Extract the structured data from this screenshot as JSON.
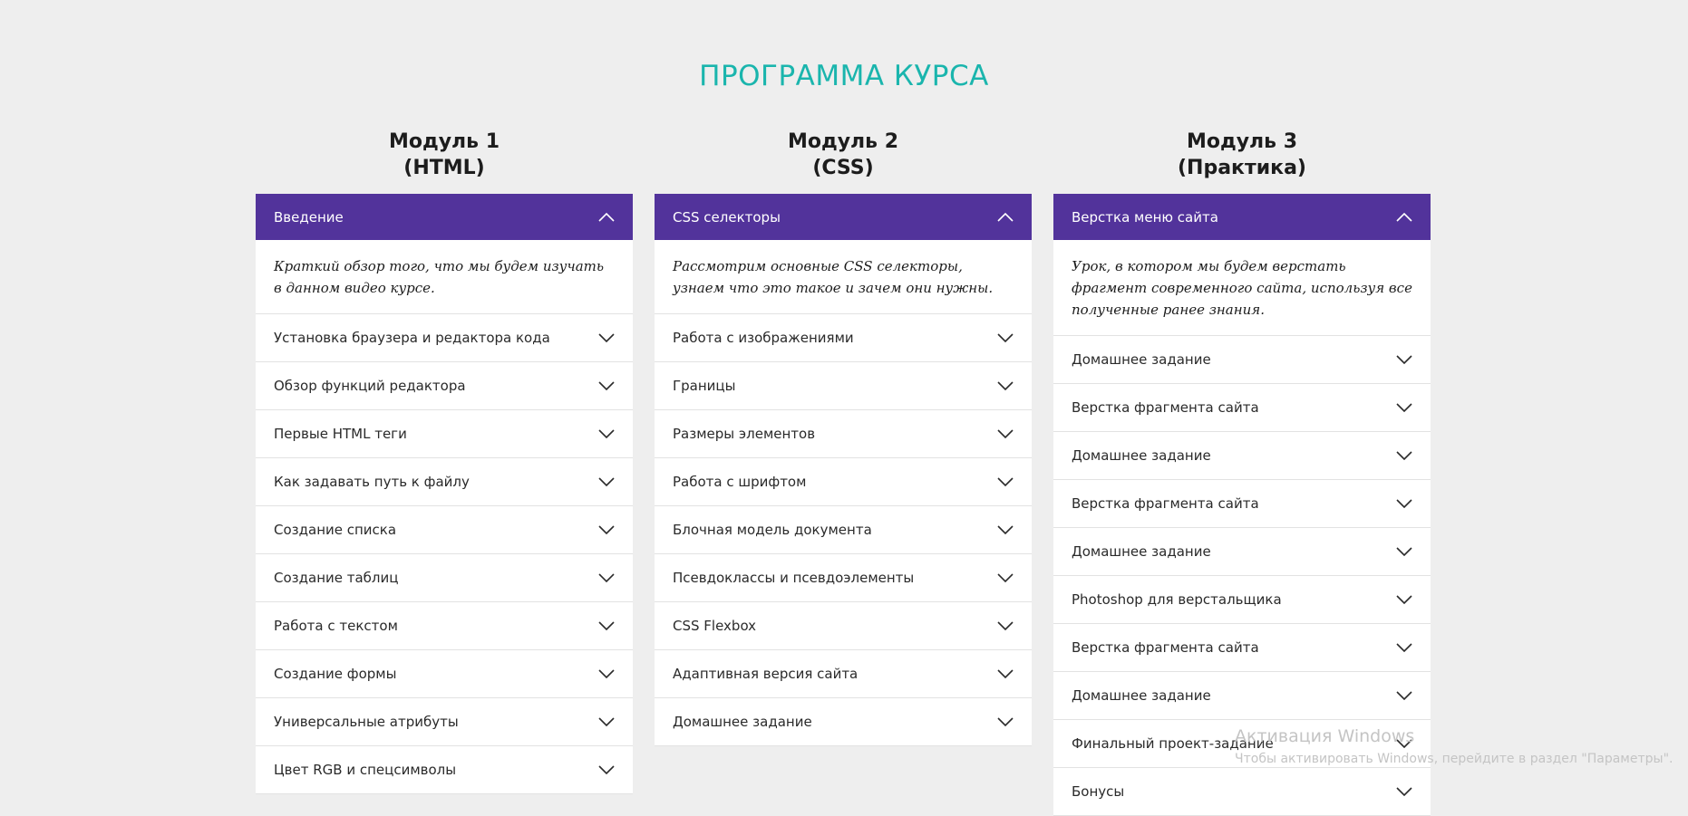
{
  "page": {
    "title": "ПРОГРАММА КУРСА"
  },
  "modules": [
    {
      "title_line1": "Модуль 1",
      "title_line2": "(HTML)",
      "open_item": {
        "label": "Введение",
        "description": "Краткий обзор того, что мы будем изучать в данном видео курсе."
      },
      "items": [
        "Установка браузера и редактора кода",
        "Обзор функций редактора",
        "Первые HTML теги",
        "Как задавать путь к файлу",
        "Создание списка",
        "Создание таблиц",
        "Работа с текстом",
        "Создание формы",
        "Универсальные атрибуты",
        "Цвет RGB и спецсимволы"
      ]
    },
    {
      "title_line1": "Модуль 2",
      "title_line2": "(CSS)",
      "open_item": {
        "label": "CSS селекторы",
        "description": "Рассмотрим основные CSS селекторы, узнаем что это такое и зачем они нужны."
      },
      "items": [
        "Работа с изображениями",
        "Границы",
        "Размеры элементов",
        "Работа с шрифтом",
        "Блочная модель документа",
        "Псевдоклассы и псевдоэлементы",
        "CSS Flexbox",
        "Адаптивная версия сайта",
        "Домашнее задание"
      ]
    },
    {
      "title_line1": "Модуль 3",
      "title_line2": "(Практика)",
      "open_item": {
        "label": "Верстка меню сайта",
        "description": "Урок, в котором мы будем верстать фрагмент современного сайта, используя все полученные ранее знания."
      },
      "items": [
        "Домашнее задание",
        "Верстка фрагмента сайта",
        "Домашнее задание",
        "Верстка фрагмента сайта",
        "Домашнее задание",
        "Photoshop для верстальщика",
        "Верстка фрагмента сайта",
        "Домашнее задание",
        "Финальный проект-задание",
        "Бонусы"
      ]
    }
  ],
  "watermark": {
    "title": "Активация Windows",
    "subtitle": "Чтобы активировать Windows, перейдите в раздел \"Параметры\"."
  },
  "icons": {
    "expanded": "chevron-up-icon",
    "collapsed": "chevron-down-icon"
  },
  "colors": {
    "accent": "#52339b",
    "title": "#1ab5ad",
    "background": "#eeeeee"
  }
}
